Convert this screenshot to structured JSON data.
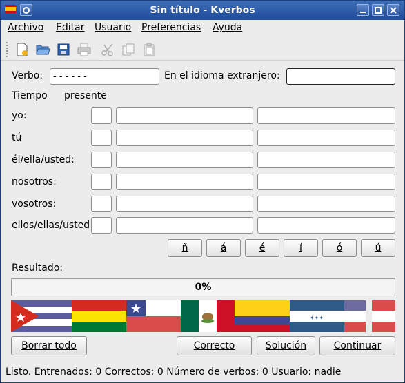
{
  "window": {
    "title": "Sin título - Kverbos"
  },
  "menu": [
    "Archivo",
    "Editar",
    "Usuario",
    "Preferencias",
    "Ayuda"
  ],
  "toolbar_icons": [
    "new-document-icon",
    "open-folder-icon",
    "save-icon",
    "print-icon",
    "cut-icon",
    "copy-icon",
    "paste-icon"
  ],
  "form": {
    "verb_label": "Verbo:",
    "verb_value": "- - - - - -",
    "foreign_label": "En el idioma extranjero:",
    "foreign_value": "",
    "tense_label": "Tiempo",
    "tense_value": "presente"
  },
  "persons": [
    "yo:",
    "tú",
    "él/ella/usted:",
    "nosotros:",
    "vosotros:",
    "ellos/ellas/usted"
  ],
  "accents": [
    "ñ",
    "á",
    "é",
    "í",
    "ó",
    "ú"
  ],
  "result": {
    "label": "Resultado:",
    "progress_text": "0%",
    "progress": 0
  },
  "buttons": {
    "clear": "Borrar todo",
    "correct": "Correcto",
    "solution": "Solución",
    "continue": "Continuar"
  },
  "status": {
    "text": "Listo.",
    "trained_label": "Entrenados:",
    "trained": "0",
    "correct_label": "Correctos:",
    "correct": "0",
    "verbs_label": "Número de verbos:",
    "verbs": "0",
    "user_label": "Usuario:",
    "user": "nadie"
  }
}
